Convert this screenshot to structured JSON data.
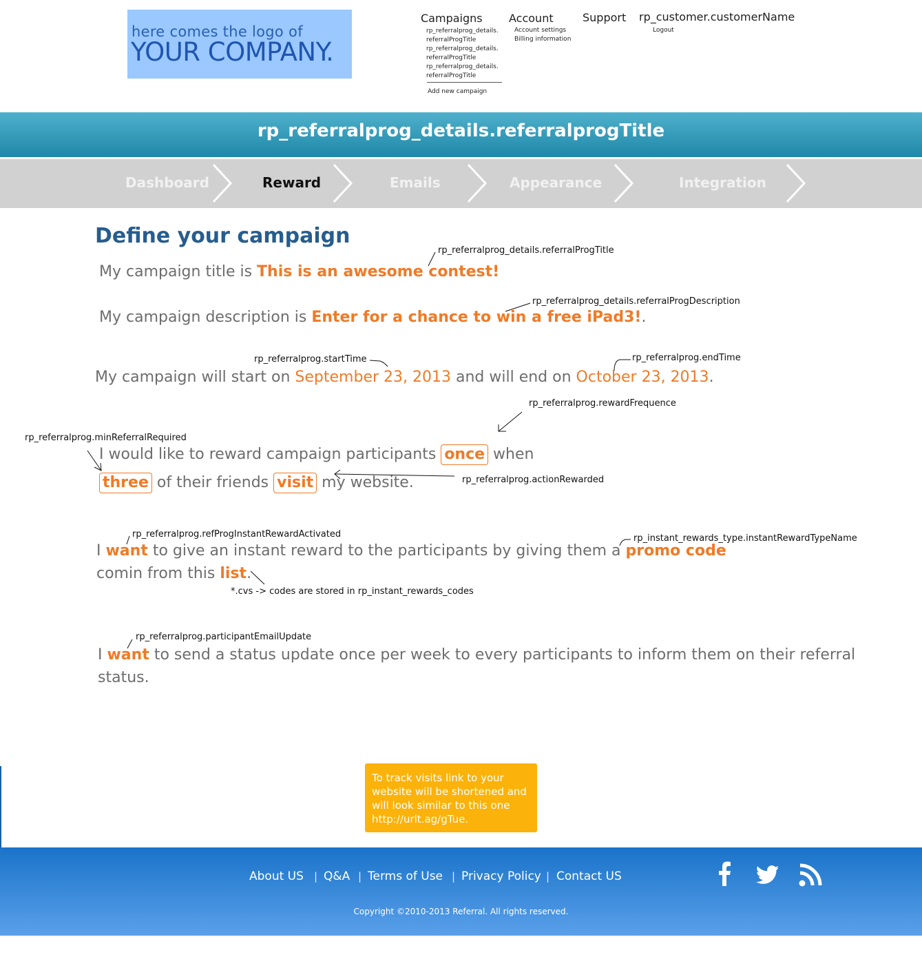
{
  "logo": {
    "line1": "here comes the logo of",
    "line2": "YOUR COMPANY."
  },
  "nav": {
    "campaigns": {
      "label": "Campaigns",
      "items": [
        "rp_referralprog_details.",
        "referralProgTitle",
        "rp_referralprog_details.",
        "referralProgTitle",
        "rp_referralprog_details.",
        "referralProgTitle"
      ],
      "add": "Add new campaign"
    },
    "account": {
      "label": "Account",
      "items": [
        "Account settings",
        "Billing information"
      ]
    },
    "support": "Support",
    "customer": {
      "label": "rp_customer.customerName",
      "logout": "Logout"
    }
  },
  "title": "rp_referralprog_details.referralprogTitle",
  "steps": [
    {
      "label": "Dashboard"
    },
    {
      "label": "Reward"
    },
    {
      "label": "Emails"
    },
    {
      "label": "Appearance"
    },
    {
      "label": "Integration"
    }
  ],
  "content": {
    "heading": "Define your campaign",
    "title_line": {
      "prefix": "My campaign title is ",
      "value": "This is an awesome contest!"
    },
    "desc_line": {
      "prefix": "My campaign description is ",
      "value": "Enter for a chance to win a free iPad3!",
      "suffix": "."
    },
    "date_line": {
      "p1": "My campaign will start on ",
      "start": "September 23, 2013",
      "p2": " and will end on ",
      "end": "October 23, 2013",
      "p3": "."
    },
    "reward_line1": {
      "p1": "I would like to reward campaign participants ",
      "freq": "once",
      "p2": " when"
    },
    "reward_line2": {
      "count": "three",
      "p1": " of their friends ",
      "action": "visit",
      "p2": " my website."
    },
    "instant_line1": {
      "p1": "I ",
      "want": "want",
      "p2": " to give an instant reward to the participants by giving them a ",
      "type": "promo code"
    },
    "instant_line2": {
      "p1": "comin from this ",
      "list": "list",
      "p2": "."
    },
    "status_line1": {
      "p1": "I ",
      "want": "want",
      "p2": " to send a status update once per week to every participants to inform them on their referral"
    },
    "status_line2": "status."
  },
  "annotations": {
    "title": "rp_referralprog_details.referralProgTitle",
    "description": "rp_referralprog_details.referralProgDescription",
    "start": "rp_referralprog.startTime",
    "end": "rp_referralprog.endTime",
    "frequence": "rp_referralprog.rewardFrequence",
    "min": "rp_referralprog.minReferralRequired",
    "action": "rp_referralprog.actionRewarded",
    "instant": "rp_referralprog.refProgInstantRewardActivated",
    "instant_type": "rp_instant_rewards_type.instantRewardTypeName",
    "codes": "*.cvs -> codes are stored in rp_instant_rewards_codes",
    "email": "rp_referralprog.participantEmailUpdate"
  },
  "tip": "To track visits link to your website will be shortened and will look similar to this one http://urlt.ag/gTue.",
  "footer": {
    "links": [
      "About  US",
      "Q&A",
      "Terms of Use",
      "Privacy Policy",
      "Contact US"
    ],
    "sep": "|",
    "copyright": "Copyright ©2010-2013 Referral. All rights reserved."
  },
  "colors": {
    "accent": "#f07a26",
    "heading": "#275d8e",
    "titlebar": "#2a95b5",
    "footer": "#1a73c9",
    "tip": "#fbb20a"
  }
}
